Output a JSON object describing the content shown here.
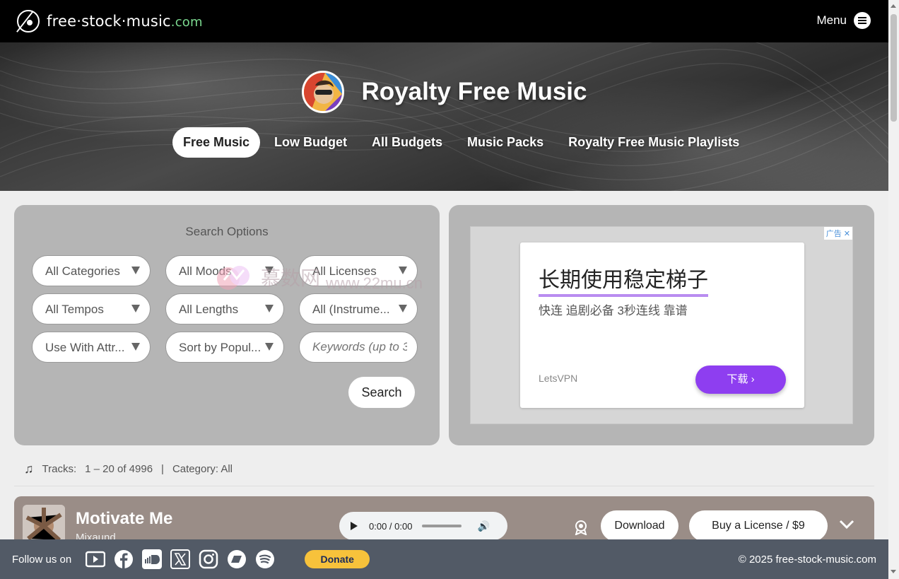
{
  "header": {
    "logo_main": "free·stock·music",
    "logo_tld": ".com",
    "menu_label": "Menu"
  },
  "hero": {
    "title": "Royalty Free Music",
    "nav": [
      "Free Music",
      "Low Budget",
      "All Budgets",
      "Music Packs",
      "Royalty Free Music Playlists"
    ]
  },
  "search": {
    "title": "Search Options",
    "selects": [
      "All Categories",
      "All Moods",
      "All Licenses",
      "All Tempos",
      "All Lengths",
      "All (Instrume...",
      "Use With Attr...",
      "Sort by Popul..."
    ],
    "keywords_placeholder": "Keywords (up to 3",
    "button": "Search"
  },
  "ad": {
    "badge": "广告",
    "headline": "长期使用稳定梯子",
    "subline": "快连 追剧必备 3秒连线 靠谱",
    "brand": "LetsVPN",
    "cta": "下载"
  },
  "tracks": {
    "label": "Tracks:",
    "range": "1 – 20 of 4996",
    "separator": "|",
    "category": "Category: All"
  },
  "track": {
    "title": "Motivate Me",
    "artist": "Mixaund",
    "time": "0:00 / 0:00",
    "download": "Download",
    "buy": "Buy a License / $9"
  },
  "footer": {
    "follow": "Follow us on",
    "social_icons": [
      "youtube-icon",
      "facebook-icon",
      "soundcloud-icon",
      "x-icon",
      "instagram-icon",
      "bandcamp-icon",
      "spotify-icon"
    ],
    "donate": "Donate",
    "copyright": "© 2025  free-stock-music.com"
  },
  "watermark": {
    "text": "慕数网",
    "url": "www.22mu.cn"
  },
  "colors": {
    "topbar": "#000000",
    "panel": "#b5b5b5",
    "track_row": "#9a8d87",
    "footer": "#525a66",
    "ad_cta": "#8e3ef0",
    "donate": "#f7c23b",
    "logo_tld": "#7bd88f"
  }
}
